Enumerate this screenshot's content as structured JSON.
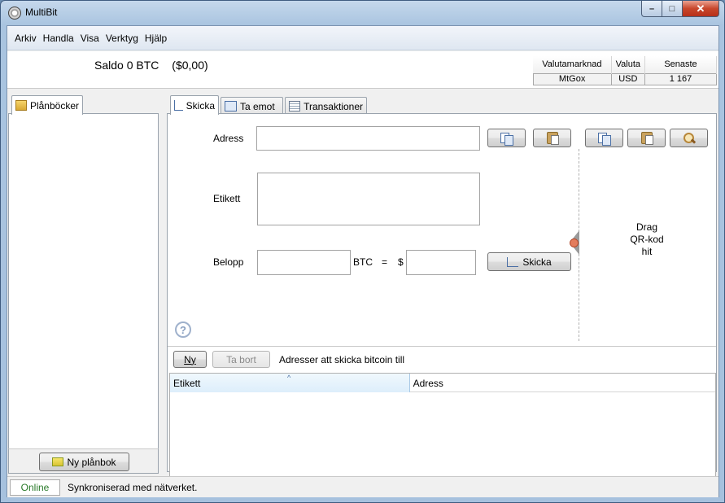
{
  "window": {
    "title": "MultiBit",
    "minimize": "–",
    "maximize": "□",
    "close": "✕"
  },
  "menu": [
    "Arkiv",
    "Handla",
    "Visa",
    "Verktyg",
    "Hjälp"
  ],
  "balance": {
    "label": "Saldo",
    "btc": "0 BTC",
    "fiat": "($0,00)"
  },
  "ticker": {
    "headers": [
      "Valutamarknad",
      "Valuta",
      "Senaste"
    ],
    "row": [
      "MtGox",
      "USD",
      "1 167"
    ]
  },
  "wallets": {
    "tab_label": "Plånböcker",
    "new_wallet_button": "Ny plånbok"
  },
  "tabs": [
    "Skicka",
    "Ta emot",
    "Transaktioner"
  ],
  "send": {
    "address_label": "Adress",
    "label_label": "Etikett",
    "amount_label": "Belopp",
    "btc_unit": "BTC",
    "equals": "=",
    "currency_symbol": "$",
    "send_button": "Skicka",
    "qr_drop_text": [
      "Drag",
      "QR-kod",
      "hit"
    ],
    "address_value": "",
    "label_value": "",
    "amount_btc_value": "",
    "amount_fiat_value": ""
  },
  "address_book": {
    "new_button": "Ny",
    "delete_button": "Ta bort",
    "title": "Adresser att skicka bitcoin till",
    "columns": [
      "Etikett",
      "Adress"
    ],
    "rows": []
  },
  "status": {
    "online": "Online",
    "message": "Synkroniserad med nätverket."
  },
  "colors": {
    "accent": "#4a6fa5",
    "online": "#2a7a2a",
    "close_button": "#c8472c"
  }
}
